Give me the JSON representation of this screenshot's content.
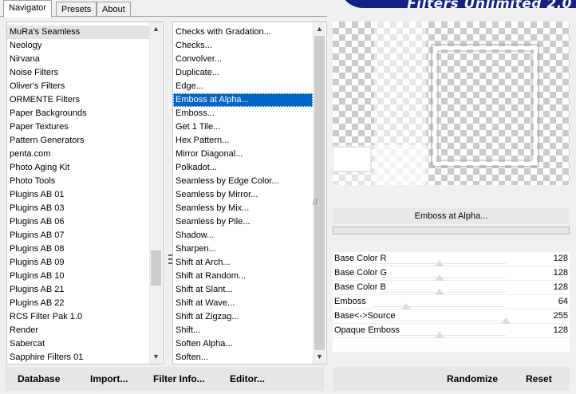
{
  "tabs": [
    {
      "label": "Navigator",
      "active": true
    },
    {
      "label": "Presets",
      "active": false
    },
    {
      "label": "About",
      "active": false
    }
  ],
  "banner_text": "Filters Unlimited 2.0",
  "categories": [
    "MuRa's Seamless",
    "Neology",
    "Nirvana",
    "Noise Filters",
    "Oliver's Filters",
    "ORMENTE Filters",
    "Paper Backgrounds",
    "Paper Textures",
    "Pattern Generators",
    "penta.com",
    "Photo Aging Kit",
    "Photo Tools",
    "Plugins AB 01",
    "Plugins AB 03",
    "Plugins AB 06",
    "Plugins AB 07",
    "Plugins AB 08",
    "Plugins AB 09",
    "Plugins AB 10",
    "Plugins AB 21",
    "Plugins AB 22",
    "RCS Filter Pak 1.0",
    "Render",
    "Sabercat",
    "Sapphire Filters 01"
  ],
  "selected_category": "MuRa's Seamless",
  "filters": [
    "Checks with Gradation...",
    "Checks...",
    "Convolver...",
    "Duplicate...",
    "Edge...",
    "Emboss at Alpha...",
    "Emboss...",
    "Get 1 Tile...",
    "Hex Pattern...",
    "Mirror Diagonal...",
    "Polkadot...",
    "Seamless by Edge Color...",
    "Seamless by Mirror...",
    "Seamless by Mix...",
    "Seamless by Pile...",
    "Shadow...",
    "Sharpen...",
    "Shift at Arch...",
    "Shift at Random...",
    "Shift at Slant...",
    "Shift at Wave...",
    "Shift at Zigzag...",
    "Shift...",
    "Soften Alpha...",
    "Soften..."
  ],
  "selected_filter": "Emboss at Alpha...",
  "filter_title": "Emboss at Alpha...",
  "params": [
    {
      "name": "Base Color R",
      "value": "128",
      "level": 128
    },
    {
      "name": "Base Color G",
      "value": "128",
      "level": 128
    },
    {
      "name": "Base Color B",
      "value": "128",
      "level": 128
    },
    {
      "name": "Emboss",
      "value": "64",
      "level": 64
    },
    {
      "name": "Base<->Source",
      "value": "255",
      "level": 255
    },
    {
      "name": "Opaque Emboss",
      "value": "128",
      "level": 128
    }
  ],
  "buttons": {
    "database": "Database",
    "import": "Import...",
    "filter_info": "Filter Info...",
    "editor": "Editor...",
    "randomize": "Randomize",
    "reset": "Reset"
  },
  "icons": {
    "scroll_up": "chevron-up-icon",
    "scroll_down": "chevron-down-icon",
    "splitter_grip": "grip-icon"
  },
  "colors": {
    "selection_blue": "#0066cc",
    "banner_blue": "#10228a"
  }
}
